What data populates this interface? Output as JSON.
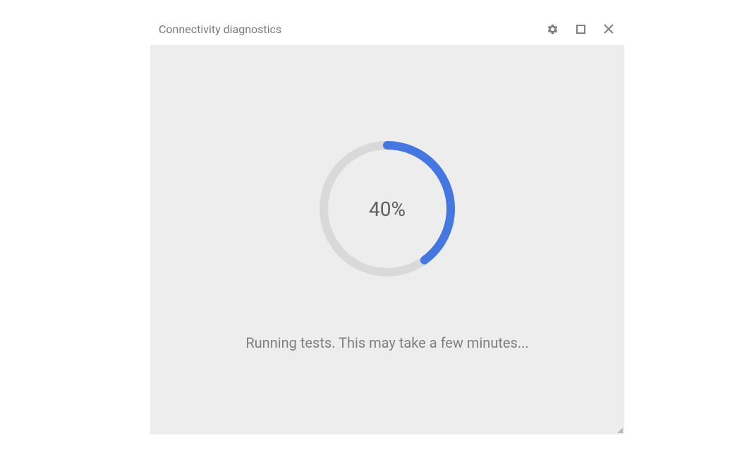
{
  "window": {
    "title": "Connectivity diagnostics"
  },
  "progress": {
    "percent": 40,
    "label": "40%"
  },
  "status": {
    "message": "Running tests. This may take a few minutes..."
  },
  "colors": {
    "accent": "#4477e0",
    "track": "#d9d9d9"
  }
}
